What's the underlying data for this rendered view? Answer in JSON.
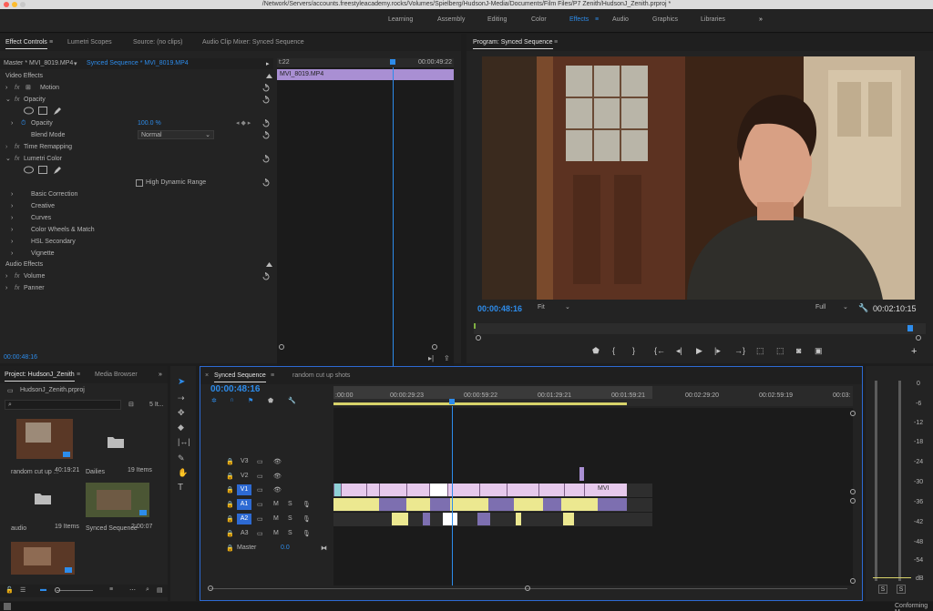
{
  "title_bar": {
    "path": "/Network/Servers/accounts.freestyleacademy.rocks/Volumes/Spielberg/HudsonJ-Media/Documents/Film Files/P7 Zenith/HudsonJ_Zenith.prproj *"
  },
  "workspaces": {
    "tabs": [
      "Learning",
      "Assembly",
      "Editing",
      "Color",
      "Effects",
      "Audio",
      "Graphics",
      "Libraries"
    ],
    "active": "Effects",
    "more": "»"
  },
  "effect_controls": {
    "tabs": [
      "Effect Controls",
      "Lumetri Scopes",
      "Source: (no clips)",
      "Audio Clip Mixer: Synced Sequence"
    ],
    "master": "Master * MVI_8019.MP4",
    "sequence": "Synced Sequence * MVI_8019.MP4",
    "time_start": "t:22",
    "time_end": "00:00:49:22",
    "clip_name": "MVI_8019.MP4",
    "video_effects": "Video Effects",
    "motion": "Motion",
    "opacity": "Opacity",
    "opacity_prop": "Opacity",
    "opacity_value": "100.0 %",
    "blend_mode_label": "Blend Mode",
    "blend_mode_value": "Normal",
    "time_remapping": "Time Remapping",
    "lumetri_color": "Lumetri Color",
    "hdr_label": "High Dynamic Range",
    "lumetri_sections": [
      "Basic Correction",
      "Creative",
      "Curves",
      "Color Wheels & Match",
      "HSL Secondary",
      "Vignette"
    ],
    "audio_effects": "Audio Effects",
    "volume": "Volume",
    "panner": "Panner",
    "current_time": "00:00:48:16"
  },
  "program_monitor": {
    "title": "Program: Synced Sequence",
    "timecode": "00:00:48:16",
    "zoom": "Fit",
    "quality": "Full",
    "duration": "00:02:10:15"
  },
  "project": {
    "tabs": [
      "Project: HudsonJ_Zenith",
      "Media Browser"
    ],
    "file": "HudsonJ_Zenith.prproj",
    "item_count": "5 It...",
    "items": [
      {
        "name": "random cut up ...",
        "meta": "40:19:21"
      },
      {
        "name": "Dailies",
        "meta": "19 Items"
      },
      {
        "name": "audio",
        "meta": "19 Items"
      },
      {
        "name": "Synced Sequence",
        "meta": "2:00:07"
      }
    ]
  },
  "timeline": {
    "tabs": [
      "Synced Sequence",
      "random cut up shots"
    ],
    "timecode": "00:00:48:16",
    "ruler": [
      ":00:00",
      "00:00:29:23",
      "00:00:59:22",
      "00:01:29:21",
      "00:01:59:21",
      "00:02:29:20",
      "00:02:59:19",
      "00:03:"
    ],
    "tracks": [
      {
        "name": "V3",
        "type": "video"
      },
      {
        "name": "V2",
        "type": "video"
      },
      {
        "name": "V1",
        "type": "video"
      },
      {
        "name": "A1",
        "type": "audio"
      },
      {
        "name": "A2",
        "type": "audio"
      },
      {
        "name": "A3",
        "type": "audio"
      }
    ],
    "master_label": "Master",
    "master_value": "0.0",
    "v1_clip_label": "MVI"
  },
  "audio_meter": {
    "scale": [
      "0",
      "-6",
      "-12",
      "-18",
      "-24",
      "-30",
      "-36",
      "-42",
      "-48",
      "-54",
      "dB"
    ],
    "solo": [
      "S",
      "S"
    ]
  },
  "status": "Conforming M",
  "colors": {
    "accent": "#2d8ceb",
    "timecode": "#e8b840",
    "video_clip": "#e6c9ec",
    "audio_clip": "#ece890"
  }
}
